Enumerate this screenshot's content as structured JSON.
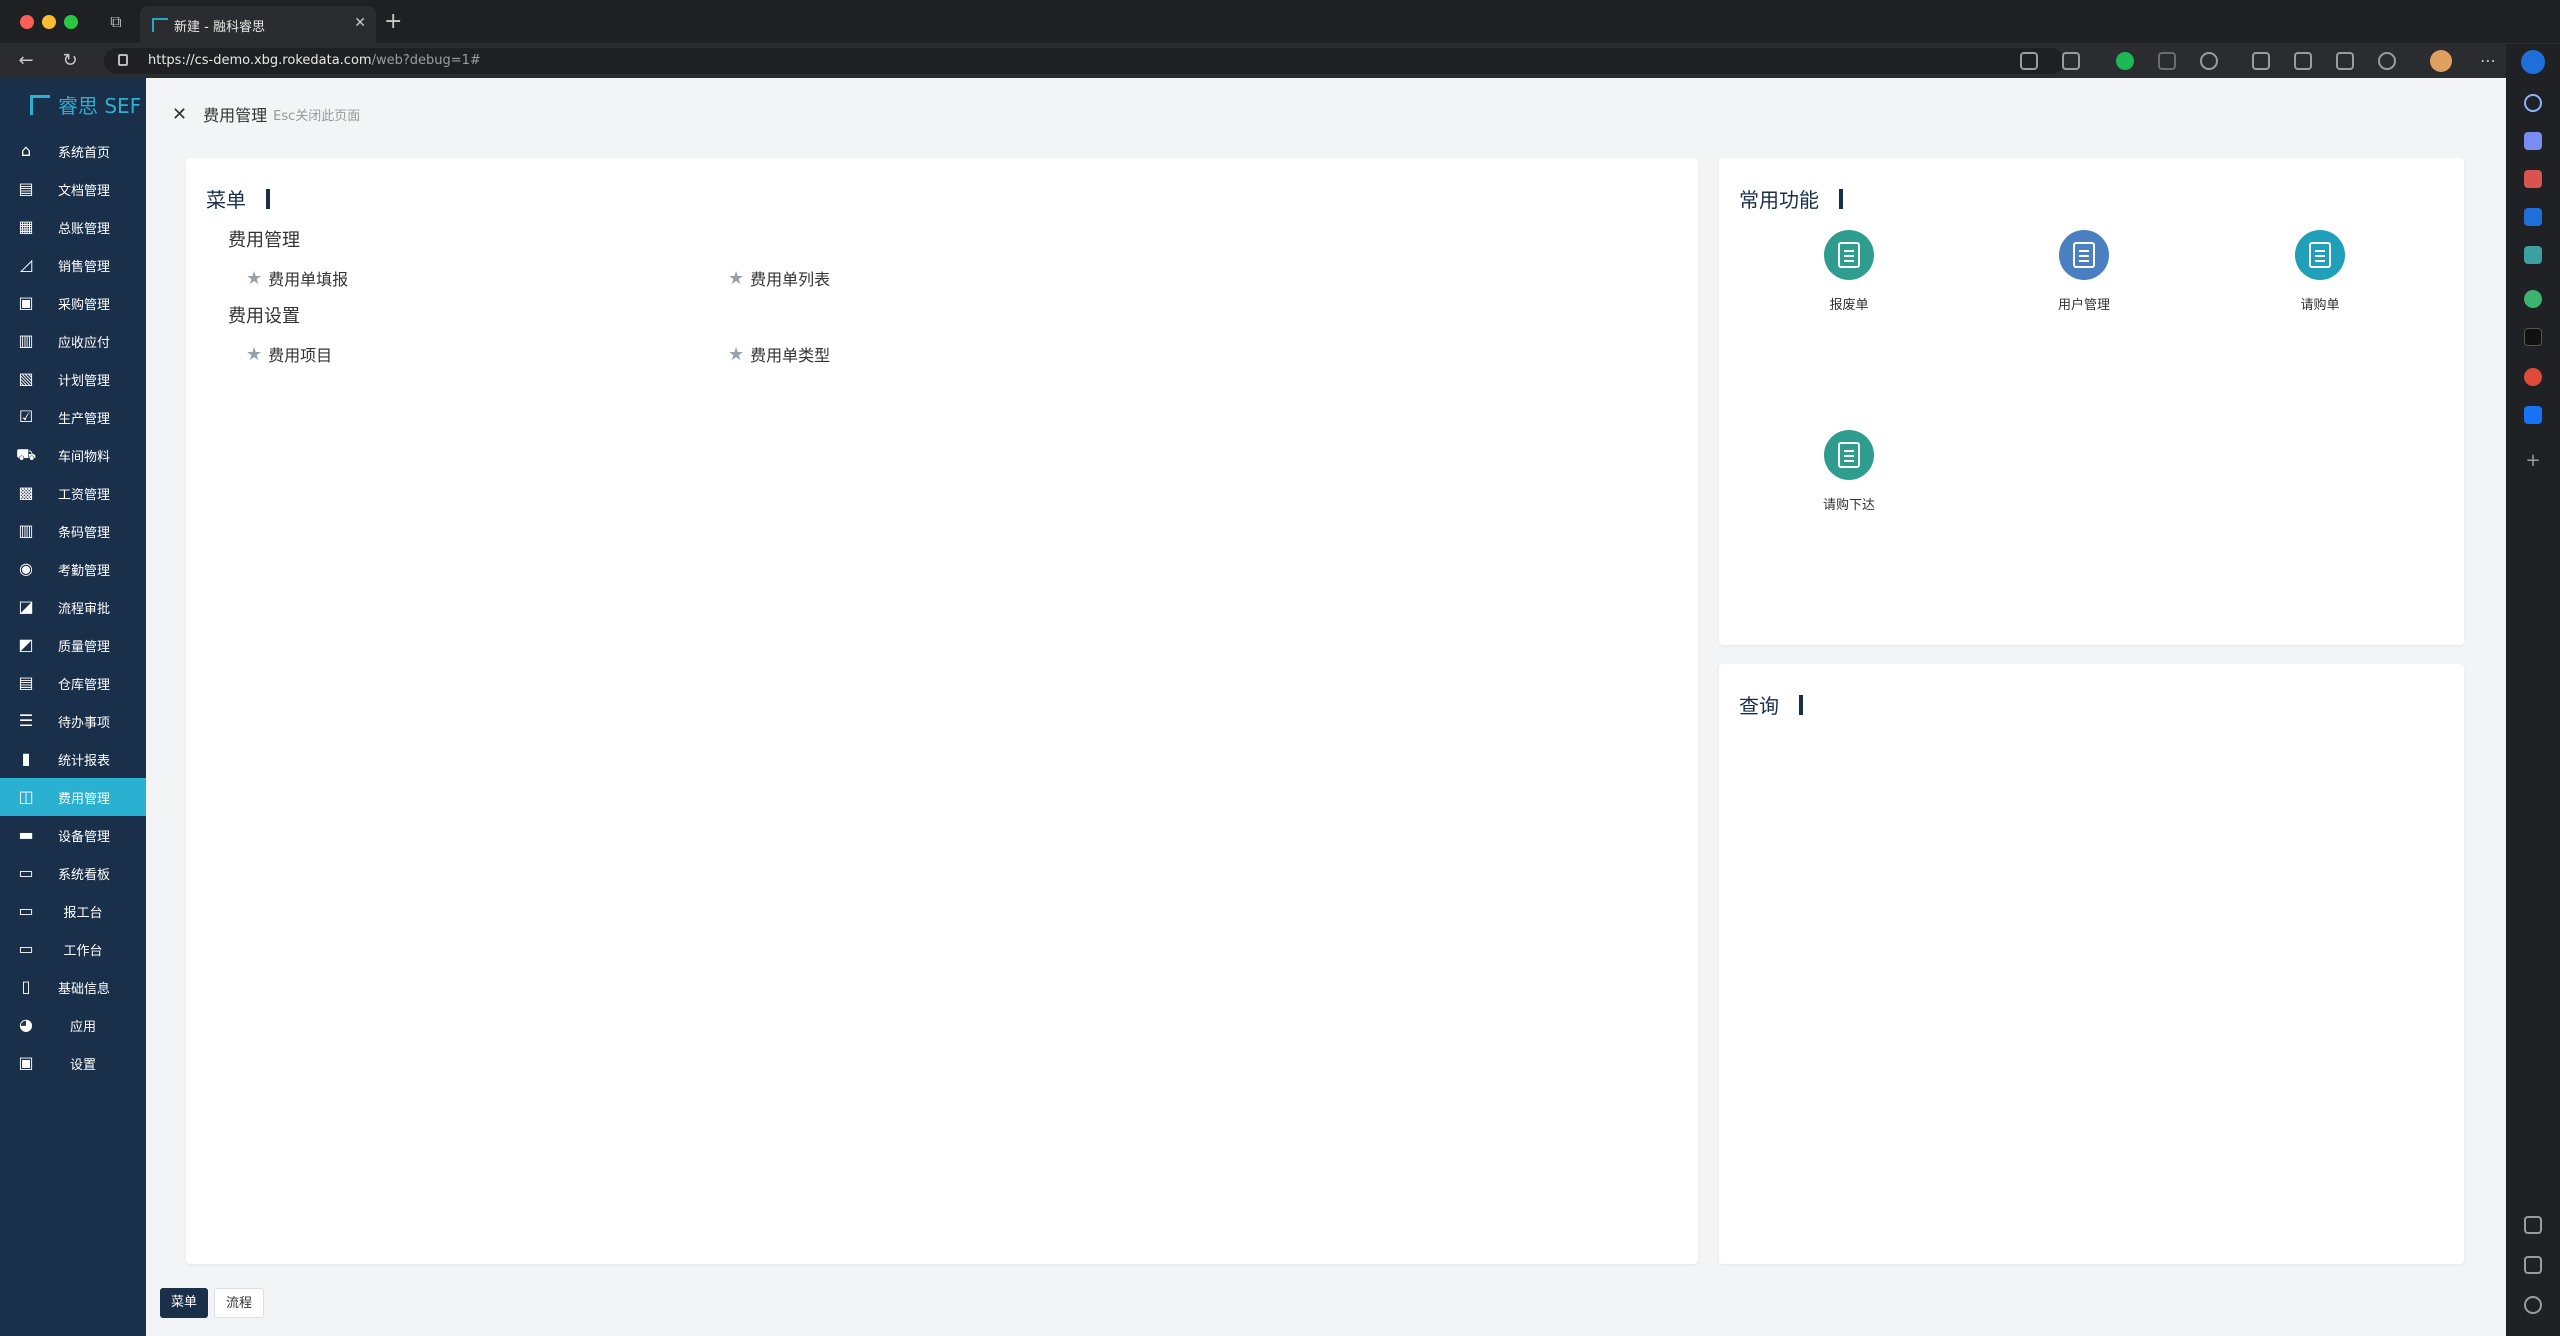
{
  "browser": {
    "tab_title": "新建 - 融科睿思",
    "url_host": "https://cs-demo.xbg.rokedata.com",
    "url_path": "/web?debug=1#"
  },
  "brand": {
    "name": "睿思 SEF"
  },
  "sidebar": {
    "items": [
      {
        "label": "系统首页",
        "icon": "home-icon"
      },
      {
        "label": "文档管理",
        "icon": "document-icon"
      },
      {
        "label": "总账管理",
        "icon": "ledger-icon"
      },
      {
        "label": "销售管理",
        "icon": "sales-chart-icon"
      },
      {
        "label": "采购管理",
        "icon": "purchase-icon"
      },
      {
        "label": "应收应付",
        "icon": "receivable-icon"
      },
      {
        "label": "计划管理",
        "icon": "plan-icon"
      },
      {
        "label": "生产管理",
        "icon": "production-icon"
      },
      {
        "label": "车间物料",
        "icon": "cart-icon"
      },
      {
        "label": "工资管理",
        "icon": "salary-icon"
      },
      {
        "label": "条码管理",
        "icon": "barcode-icon"
      },
      {
        "label": "考勤管理",
        "icon": "attendance-icon"
      },
      {
        "label": "流程审批",
        "icon": "workflow-icon"
      },
      {
        "label": "质量管理",
        "icon": "quality-icon"
      },
      {
        "label": "仓库管理",
        "icon": "warehouse-icon"
      },
      {
        "label": "待办事项",
        "icon": "todo-icon"
      },
      {
        "label": "统计报表",
        "icon": "bar-chart-icon"
      },
      {
        "label": "费用管理",
        "icon": "expense-icon",
        "active": true
      },
      {
        "label": "设备管理",
        "icon": "equipment-icon"
      },
      {
        "label": "系统看板",
        "icon": "dashboard-icon"
      },
      {
        "label": "报工台",
        "icon": "report-station-icon"
      },
      {
        "label": "工作台",
        "icon": "workbench-icon"
      },
      {
        "label": "基础信息",
        "icon": "basic-info-icon"
      },
      {
        "label": "应用",
        "icon": "apps-icon"
      },
      {
        "label": "设置",
        "icon": "settings-icon"
      }
    ]
  },
  "page": {
    "title": "费用管理",
    "hint": "Esc关闭此页面"
  },
  "menu_card": {
    "title": "菜单",
    "groups": [
      {
        "label": "费用管理",
        "items": [
          "费用单填报",
          "费用单列表"
        ]
      },
      {
        "label": "费用设置",
        "items": [
          "费用项目",
          "费用单类型"
        ]
      }
    ]
  },
  "common_card": {
    "title": "常用功能",
    "items": [
      {
        "label": "报废单",
        "color": "#2f9d8e"
      },
      {
        "label": "用户管理",
        "color": "#4a7fc1"
      },
      {
        "label": "请购单",
        "color": "#1f9fb8"
      },
      {
        "label": "请购下达",
        "color": "#2f9d8e"
      }
    ]
  },
  "query_card": {
    "title": "查询"
  },
  "bottom_tabs": {
    "menu": "菜单",
    "flow": "流程"
  }
}
